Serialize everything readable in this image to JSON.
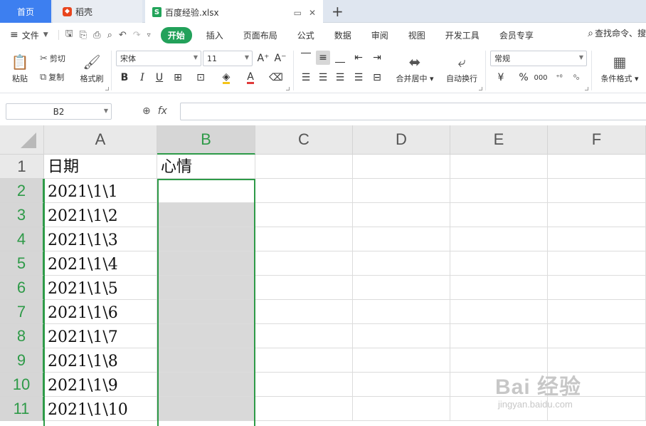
{
  "tabs": {
    "home": "首页",
    "daoke": "稻壳",
    "file": "百度经验.xlsx",
    "add": "+"
  },
  "menu": {
    "file": "文件",
    "tabs": [
      "开始",
      "插入",
      "页面布局",
      "公式",
      "数据",
      "审阅",
      "视图",
      "开发工具",
      "会员专享"
    ],
    "search": "查找命令、搜"
  },
  "ribbon": {
    "paste": "粘贴",
    "cut": "剪切",
    "copy": "复制",
    "format_painter": "格式刷",
    "font_name": "宋体",
    "font_size": "11",
    "merge_center": "合并居中",
    "wrap_text": "自动换行",
    "number_format": "常规",
    "cond_format": "条件格式"
  },
  "formula_bar": {
    "name_box": "B2",
    "fx": "fx",
    "value": ""
  },
  "sheet": {
    "columns": [
      "A",
      "B",
      "C",
      "D",
      "E",
      "F"
    ],
    "rows": [
      "1",
      "2",
      "3",
      "4",
      "5",
      "6",
      "7",
      "8",
      "9",
      "10",
      "11"
    ],
    "colA": [
      "日期",
      "2021\\1\\1",
      "2021\\1\\2",
      "2021\\1\\3",
      "2021\\1\\4",
      "2021\\1\\5",
      "2021\\1\\6",
      "2021\\1\\7",
      "2021\\1\\8",
      "2021\\1\\9",
      "2021\\1\\10"
    ],
    "colB": [
      "心情",
      "",
      "",
      "",
      "",
      "",
      "",
      "",
      "",
      "",
      ""
    ]
  },
  "watermark": {
    "main": "Bai 经验",
    "sub": "jingyan.baidu.com"
  }
}
